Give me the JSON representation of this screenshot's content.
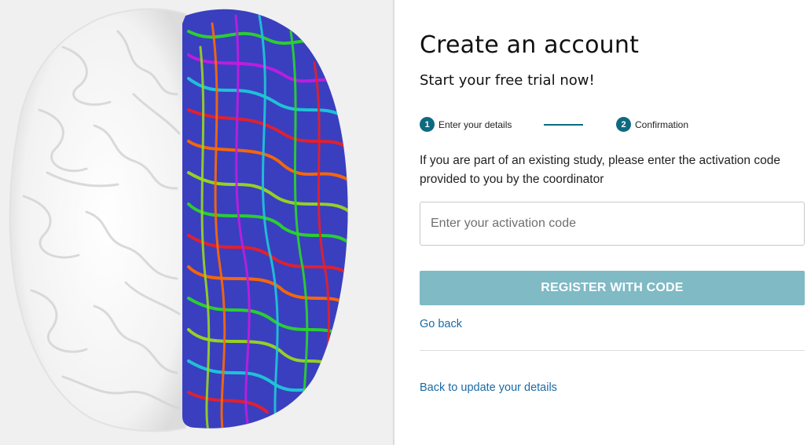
{
  "hero": {
    "image": "brain-illustration",
    "colors": {
      "background": "#f0f0f0",
      "cortex": "#f7f7f7",
      "fiber_palette": [
        "#e8202a",
        "#ff6a00",
        "#2bd62a",
        "#2a3ad8",
        "#c21ce0",
        "#1ec9d8",
        "#9ad81c"
      ]
    }
  },
  "form": {
    "title": "Create an account",
    "subtitle": "Start your free trial now!",
    "steps": [
      {
        "number": "1",
        "label": "Enter your details",
        "state": "active"
      },
      {
        "number": "2",
        "label": "Confirmation",
        "state": "active"
      }
    ],
    "info_text": "If you are part of an existing study, please enter the activation code provided to you by the coordinator",
    "activation_input": {
      "value": "",
      "placeholder": "Enter your activation code"
    },
    "register_button": "REGISTER WITH CODE",
    "go_back_link": "Go back",
    "back_update_link": "Back to update your details"
  },
  "colors": {
    "accent": "#0e6a80",
    "button": "#7fbac5",
    "link": "#1b6aa5"
  }
}
